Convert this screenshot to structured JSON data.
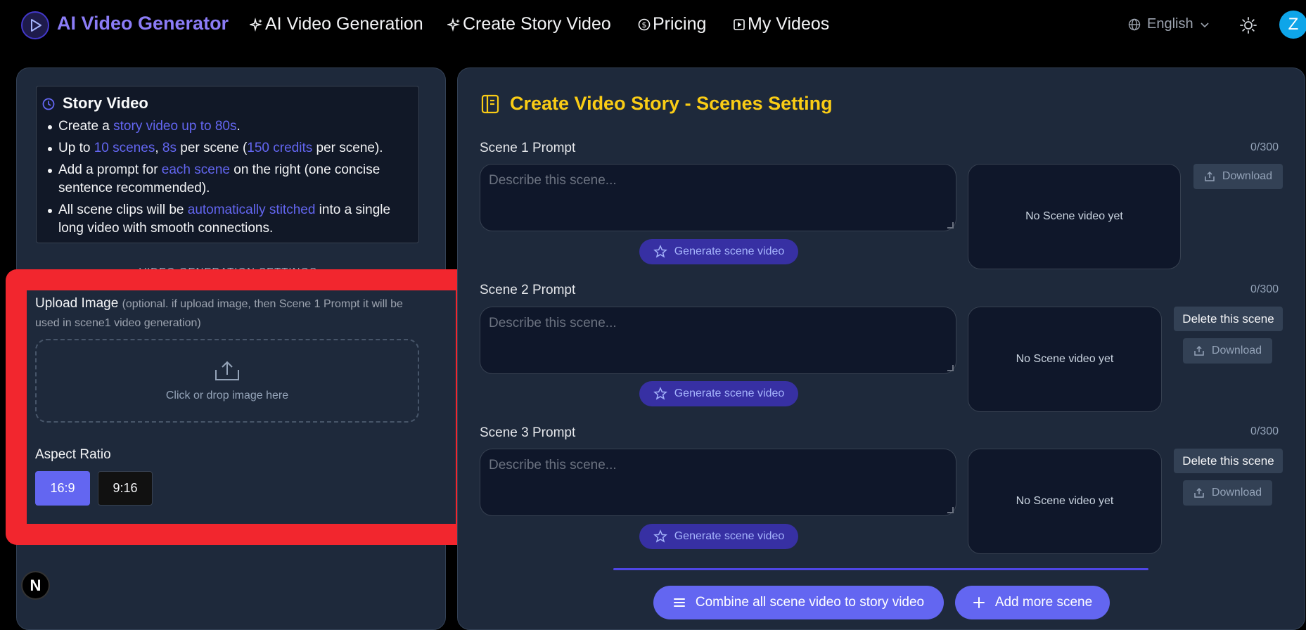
{
  "header": {
    "brand": "AI Video Generator",
    "nav": [
      {
        "label": "AI Video Generation",
        "icon": "sparkle-icon"
      },
      {
        "label": "Create Story Video",
        "icon": "sparkle-icon"
      },
      {
        "label": "Pricing",
        "icon": "dollar-icon"
      },
      {
        "label": "My Videos",
        "icon": "play-icon"
      }
    ],
    "language": "English",
    "avatar_initial": "Z"
  },
  "info": {
    "title": "Story Video",
    "items": [
      {
        "a": "Create a ",
        "h1": "story video up to 80s",
        "b": "."
      },
      {
        "a": "Up to ",
        "h1": "10 scenes",
        "b": ", ",
        "h2": "8s",
        "c": " per scene (",
        "h3": "150 credits",
        "d": " per scene)."
      },
      {
        "a": "Add a prompt for ",
        "h1": "each scene",
        "b": " on the right (one concise sentence recommended)."
      },
      {
        "a": "All scene clips will be ",
        "h1": "automatically stitched",
        "b": " into a single long video with smooth connections."
      }
    ]
  },
  "settings": {
    "heading": "VIDEO GENERATION SETTINGS",
    "upload_label": "Upload Image",
    "upload_hint": "(optional. if upload image, then Scene 1 Prompt it will be used in scene1 video generation)",
    "drop_text": "Click or drop image here",
    "aspect_label": "Aspect Ratio",
    "ratios": [
      "16:9",
      "9:16"
    ]
  },
  "story": {
    "title": "Create Video Story - Scenes Setting",
    "placeholder": "Describe this scene...",
    "generate_label": "Generate scene video",
    "no_video": "No Scene video yet",
    "download_label": "Download",
    "delete_label": "Delete this scene",
    "scenes": [
      {
        "label": "Scene 1 Prompt",
        "counter": "0/300"
      },
      {
        "label": "Scene 2 Prompt",
        "counter": "0/300"
      },
      {
        "label": "Scene 3 Prompt",
        "counter": "0/300"
      }
    ],
    "combine_label": "Combine all scene video to story video",
    "add_label": "Add more scene"
  },
  "colors": {
    "accent": "#6366f1",
    "title_yellow": "#facc15",
    "highlight_red": "#f2262e"
  }
}
